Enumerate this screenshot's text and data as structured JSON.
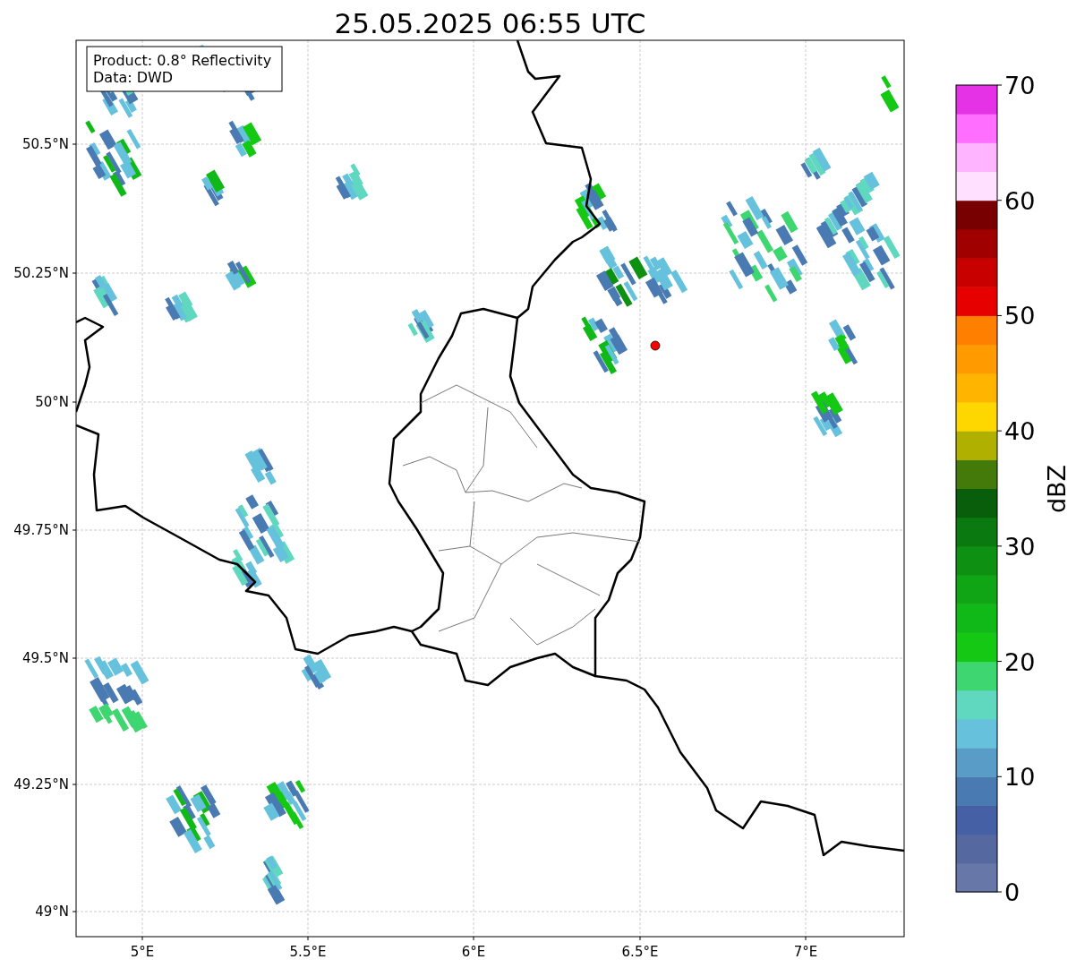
{
  "title": "25.05.2025 06:55 UTC",
  "info_box": [
    "Product: 0.8° Reflectivity",
    "Data: DWD"
  ],
  "map": {
    "yticks": [
      "50.5°N",
      "50.25°N",
      "50°N",
      "49.75°N",
      "49.5°N",
      "49.25°N",
      "49°N"
    ],
    "xticks": [
      "5°E",
      "5.5°E",
      "6°E",
      "6.5°E",
      "7°E"
    ]
  },
  "colorbar": {
    "label": "dBZ",
    "ticks": [
      "70",
      "60",
      "50",
      "40",
      "30",
      "20",
      "10",
      "0"
    ],
    "bands": [
      {
        "color": "#6677a8"
      },
      {
        "color": "#5568a0"
      },
      {
        "color": "#4560a5"
      },
      {
        "color": "#4a7ab2"
      },
      {
        "color": "#5a9cc8"
      },
      {
        "color": "#66c2dc"
      },
      {
        "color": "#60d8c0"
      },
      {
        "color": "#3dd670"
      },
      {
        "color": "#14c814"
      },
      {
        "color": "#10b818"
      },
      {
        "color": "#10a514"
      },
      {
        "color": "#0e9012"
      },
      {
        "color": "#0a7a10"
      },
      {
        "color": "#085e0a"
      },
      {
        "color": "#447a0a"
      },
      {
        "color": "#b0b000"
      },
      {
        "color": "#ffd700"
      },
      {
        "color": "#ffb400"
      },
      {
        "color": "#ff9a00"
      },
      {
        "color": "#ff8000"
      },
      {
        "color": "#e60000"
      },
      {
        "color": "#c80000"
      },
      {
        "color": "#a00000"
      },
      {
        "color": "#780000"
      },
      {
        "color": "#ffe0ff"
      },
      {
        "color": "#ffb4ff"
      },
      {
        "color": "#ff6eff"
      },
      {
        "color": "#e632e6"
      }
    ]
  }
}
